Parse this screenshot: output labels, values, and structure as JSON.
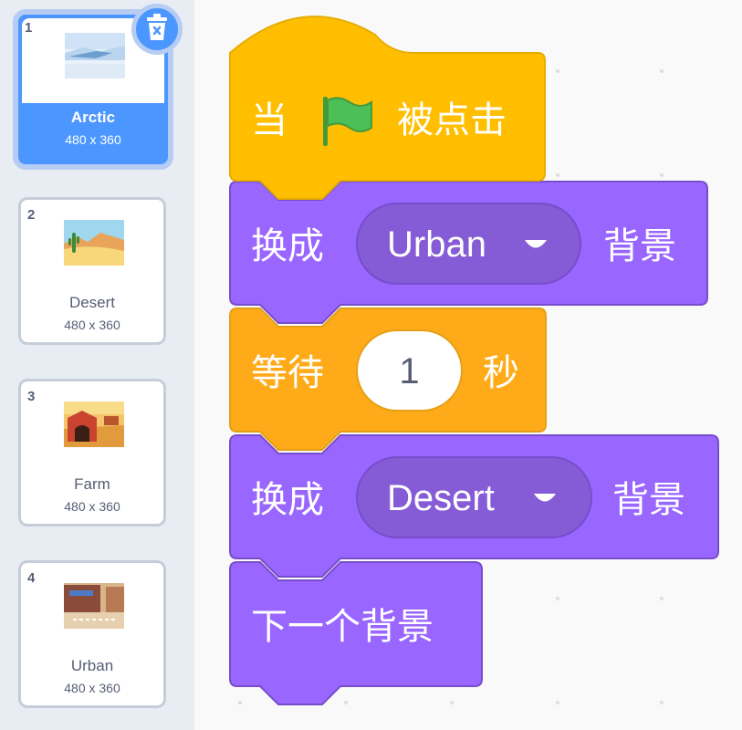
{
  "backdrops": [
    {
      "number": "1",
      "name": "Arctic",
      "size": "480 x 360"
    },
    {
      "number": "2",
      "name": "Desert",
      "size": "480 x 360"
    },
    {
      "number": "3",
      "name": "Farm",
      "size": "480 x 360"
    },
    {
      "number": "4",
      "name": "Urban",
      "size": "480 x 360"
    }
  ],
  "selected_backdrop": "Arctic",
  "blocks": {
    "hat": {
      "prefix": "当",
      "suffix": "被点击",
      "icon": "green-flag-icon"
    },
    "switch1": {
      "label": "换成",
      "value": "Urban",
      "suffix": "背景"
    },
    "wait": {
      "label": "等待",
      "value": "1",
      "suffix": "秒"
    },
    "switch2": {
      "label": "换成",
      "value": "Desert",
      "suffix": "背景"
    },
    "next": {
      "label": "下一个背景"
    }
  },
  "colors": {
    "events": "#ffbf00",
    "looks": "#9966ff",
    "control": "#ffab19",
    "selection": "#4c97ff"
  }
}
